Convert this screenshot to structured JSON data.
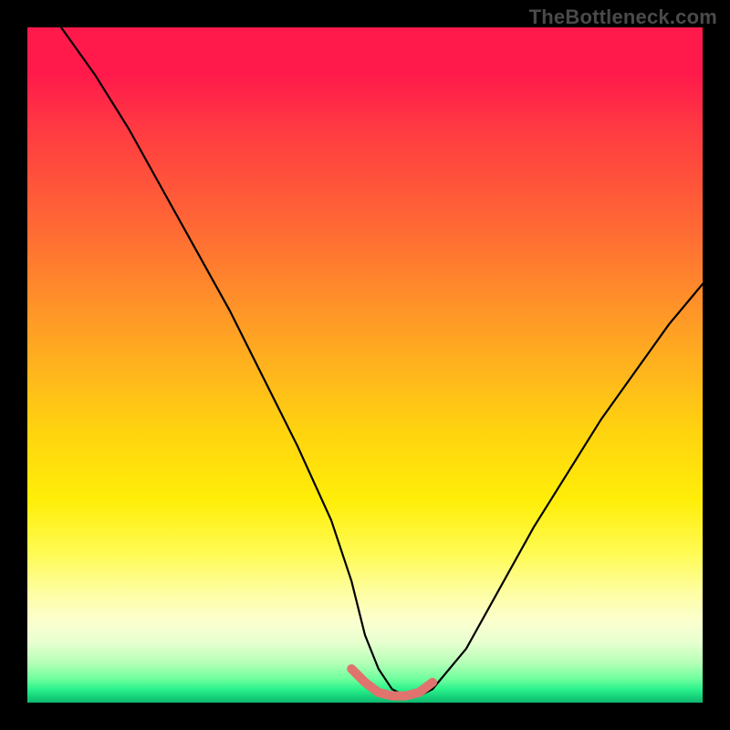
{
  "watermark": "TheBottleneck.com",
  "chart_data": {
    "type": "line",
    "title": "",
    "xlabel": "",
    "ylabel": "",
    "xlim": [
      0,
      100
    ],
    "ylim": [
      0,
      100
    ],
    "series": [
      {
        "name": "main-curve",
        "color": "#000000",
        "x": [
          5,
          10,
          15,
          20,
          25,
          30,
          35,
          40,
          45,
          48,
          50,
          52,
          54,
          56,
          58,
          60,
          65,
          70,
          75,
          80,
          85,
          90,
          95,
          100
        ],
        "y": [
          100,
          93,
          85,
          76,
          67,
          58,
          48,
          38,
          27,
          18,
          10,
          5,
          2,
          1,
          1,
          2,
          8,
          17,
          26,
          34,
          42,
          49,
          56,
          62
        ]
      },
      {
        "name": "trough-highlight",
        "color": "#e0736d",
        "x": [
          48,
          50,
          52,
          54,
          56,
          58,
          60
        ],
        "y": [
          5,
          3,
          1.5,
          1,
          1,
          1.5,
          3
        ]
      }
    ],
    "gradient_stops": [
      {
        "pos": 0,
        "color": "#ff1a4b"
      },
      {
        "pos": 50,
        "color": "#ffd40f"
      },
      {
        "pos": 78,
        "color": "#fffb55"
      },
      {
        "pos": 94,
        "color": "#b8ffb8"
      },
      {
        "pos": 100,
        "color": "#0fb86e"
      }
    ]
  }
}
